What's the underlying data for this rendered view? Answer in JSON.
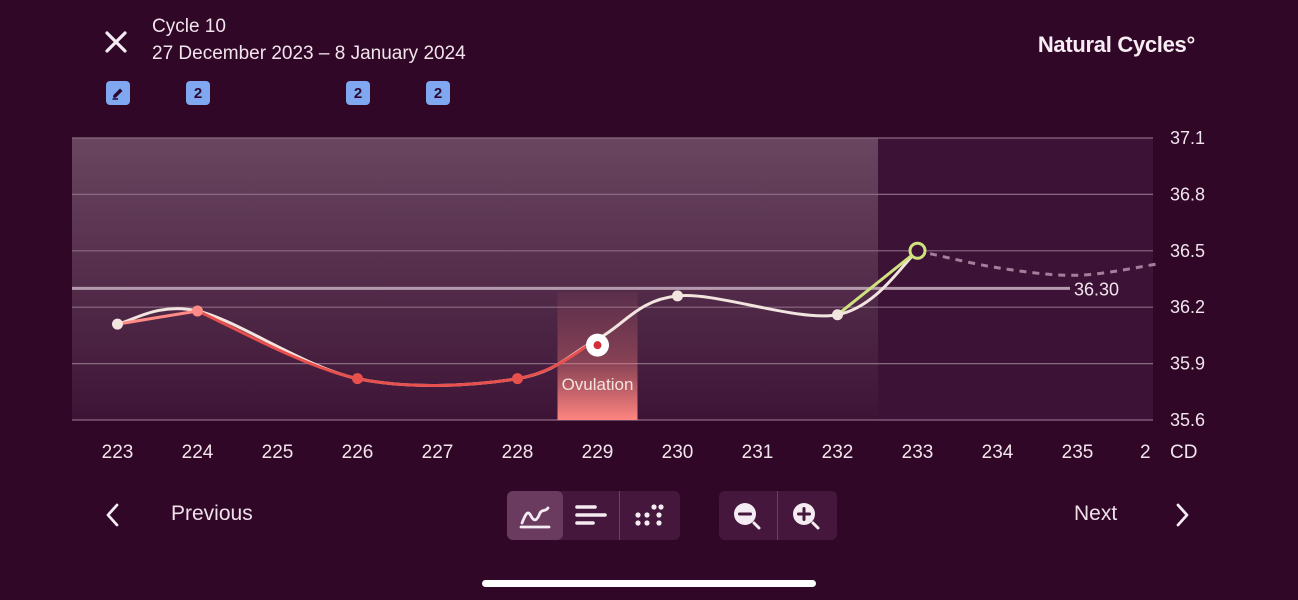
{
  "header": {
    "close_icon": "close-icon",
    "cycle_title": "Cycle 10",
    "date_range": "27 December 2023 – 8 January 2024",
    "brand": "Natural Cycles°"
  },
  "badges": [
    {
      "type": "pencil-icon",
      "day": 223
    },
    {
      "text": "2",
      "day": 224
    },
    {
      "text": "2",
      "day": 226
    },
    {
      "text": "2",
      "day": 228
    }
  ],
  "colors": {
    "background": "#310728",
    "red_day": "#e8504d",
    "green_day": "#f2e4de",
    "fertile_window": "#ff8580",
    "predicted": "#d0e27f",
    "badge": "#7fa8f0"
  },
  "chart_data": {
    "type": "line",
    "ylim": [
      35.6,
      37.1
    ],
    "y_ticks": [
      "37.1",
      "36.8",
      "36.5",
      "36.2",
      "35.9",
      "35.6"
    ],
    "x_ticks": [
      "223",
      "224",
      "225",
      "226",
      "227",
      "228",
      "229",
      "230",
      "231",
      "232",
      "233",
      "234",
      "235",
      "2"
    ],
    "x_unit_label": "CD",
    "cover_line": {
      "value": 36.3,
      "label": "36.30"
    },
    "ovulation_day": 229,
    "ovulation_label": "Ovulation",
    "series": [
      {
        "values": [
          {
            "x": 223,
            "y": 36.11
          },
          {
            "x": 224,
            "y": 36.18
          },
          {
            "x": 226,
            "y": 35.82
          },
          {
            "x": 228,
            "y": 35.82
          },
          {
            "x": 229,
            "y": 36.03
          },
          {
            "x": 230,
            "y": 36.26
          },
          {
            "x": 232,
            "y": 36.16
          },
          {
            "x": 233,
            "y": 36.5
          }
        ]
      },
      {
        "values": [
          {
            "x": 233,
            "y": 36.5
          },
          {
            "x": 234,
            "y": 36.41
          },
          {
            "x": 235,
            "y": 36.37
          },
          {
            "x": 236,
            "y": 36.43
          }
        ]
      }
    ]
  },
  "footer": {
    "previous_label": "Previous",
    "next_label": "Next",
    "view_modes": [
      "graph-view-icon",
      "bar-view-icon",
      "dots-view-icon"
    ],
    "zoom": [
      "zoom-out-icon",
      "zoom-in-icon"
    ]
  }
}
